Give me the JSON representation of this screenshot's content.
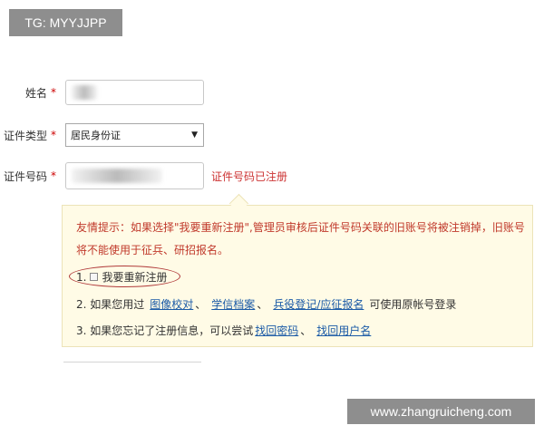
{
  "watermarks": {
    "top_left": "TG: MYYJJPP",
    "bottom_right": "www.zhangruicheng.com"
  },
  "form": {
    "name": {
      "label": "姓名",
      "required_mark": "*",
      "value": ""
    },
    "id_type": {
      "label": "证件类型",
      "required_mark": "*",
      "selected": "居民身份证",
      "arrow": "▼"
    },
    "id_number": {
      "label": "证件号码",
      "required_mark": "*",
      "value": "",
      "status_message": "证件号码已注册"
    }
  },
  "tip": {
    "warning": "友情提示：如果选择\"我要重新注册\",管理员审核后证件号码关联的旧账号将被注销掉，旧账号将不能使用于征兵、研招报名。",
    "line1": {
      "number": "1.",
      "checkbox_label": "我要重新注册",
      "checked": false
    },
    "line2": {
      "prefix": "2. 如果您用过",
      "links": [
        "图像校对",
        "学信档案",
        "兵役登记/应征报名"
      ],
      "separator": "、",
      "suffix": "可使用原帐号登录"
    },
    "line3": {
      "prefix": "3. 如果您忘记了注册信息，可以尝试",
      "links": [
        "找回密码",
        "找回用户名"
      ],
      "separator": "、"
    }
  }
}
